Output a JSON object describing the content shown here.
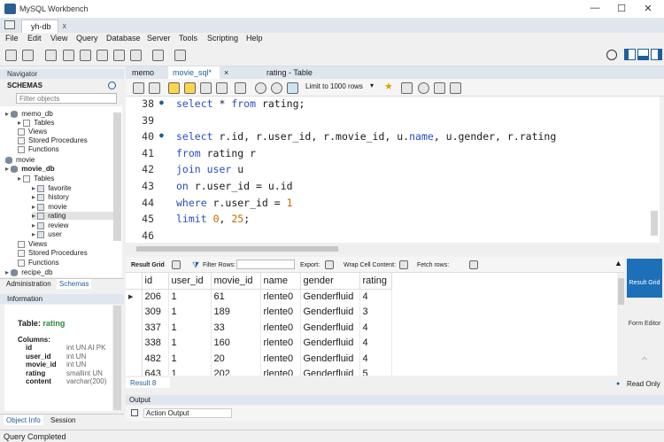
{
  "window": {
    "title": "MySQL Workbench",
    "controls": [
      "—",
      "☐",
      "✕"
    ]
  },
  "connection_tab": {
    "label": "yh-db",
    "close": "x"
  },
  "menu": [
    "File",
    "Edit",
    "View",
    "Query",
    "Database",
    "Server",
    "Tools",
    "Scripting",
    "Help"
  ],
  "navigator": {
    "header": "Navigator",
    "schemas_label": "SCHEMAS",
    "filter_placeholder": "Filter objects",
    "tree": [
      {
        "label": "memo_db",
        "level": 0,
        "kind": "db"
      },
      {
        "label": "Tables",
        "level": 1,
        "kind": "folder"
      },
      {
        "label": "Views",
        "level": 1,
        "kind": "folder"
      },
      {
        "label": "Stored Procedures",
        "level": 1,
        "kind": "folder"
      },
      {
        "label": "Functions",
        "level": 1,
        "kind": "folder"
      },
      {
        "label": "movie",
        "level": 0,
        "kind": "db"
      },
      {
        "label": "movie_db",
        "level": 0,
        "kind": "db",
        "bold": true
      },
      {
        "label": "Tables",
        "level": 1,
        "kind": "folder"
      },
      {
        "label": "favorite",
        "level": 2,
        "kind": "table"
      },
      {
        "label": "history",
        "level": 2,
        "kind": "table"
      },
      {
        "label": "movie",
        "level": 2,
        "kind": "table"
      },
      {
        "label": "rating",
        "level": 2,
        "kind": "table",
        "selected": true
      },
      {
        "label": "review",
        "level": 2,
        "kind": "table"
      },
      {
        "label": "user",
        "level": 2,
        "kind": "table"
      },
      {
        "label": "Views",
        "level": 1,
        "kind": "folder"
      },
      {
        "label": "Stored Procedures",
        "level": 1,
        "kind": "folder"
      },
      {
        "label": "Functions",
        "level": 1,
        "kind": "folder"
      },
      {
        "label": "recipe_db",
        "level": 0,
        "kind": "db"
      }
    ],
    "bottom_tabs": [
      "Administration",
      "Schemas"
    ]
  },
  "information": {
    "header": "Information",
    "table_label": "Table:",
    "table_name": "rating",
    "columns_label": "Columns:",
    "columns": [
      {
        "name": "id",
        "type": "int UN AI PK"
      },
      {
        "name": "user_id",
        "type": "int UN"
      },
      {
        "name": "movie_id",
        "type": "int UN"
      },
      {
        "name": "rating",
        "type": "smallint UN"
      },
      {
        "name": "content",
        "type": "varchar(200)"
      }
    ],
    "tabs": [
      "Object Info",
      "Session"
    ]
  },
  "editor_tabs": [
    {
      "label": "memo"
    },
    {
      "label": "movie_sql*",
      "active": true
    },
    {
      "label": "×"
    },
    {
      "label": "rating - Table"
    }
  ],
  "editor_toolbar": {
    "limit": "Limit to 1000 rows"
  },
  "code_lines": [
    {
      "n": "38",
      "dot": true,
      "tokens": [
        [
          "kw",
          "select"
        ],
        [
          "t",
          " * "
        ],
        [
          "kw",
          "from"
        ],
        [
          "t",
          " rating;"
        ]
      ]
    },
    {
      "n": "39",
      "dot": false,
      "tokens": []
    },
    {
      "n": "40",
      "dot": true,
      "tokens": [
        [
          "kw",
          "select"
        ],
        [
          "t",
          " r.id, r.user_id, r.movie_id, u."
        ],
        [
          "kw",
          "name"
        ],
        [
          "t",
          ", u.gender, r.rating"
        ]
      ]
    },
    {
      "n": "41",
      "dot": false,
      "tokens": [
        [
          "kw",
          "from"
        ],
        [
          "t",
          " rating r"
        ]
      ]
    },
    {
      "n": "42",
      "dot": false,
      "tokens": [
        [
          "kw",
          "join"
        ],
        [
          "t",
          " "
        ],
        [
          "kw",
          "user"
        ],
        [
          "t",
          " u"
        ]
      ]
    },
    {
      "n": "43",
      "dot": false,
      "tokens": [
        [
          "kw",
          "on"
        ],
        [
          "t",
          " r.user_id = u.id"
        ]
      ]
    },
    {
      "n": "44",
      "dot": false,
      "tokens": [
        [
          "kw",
          "where"
        ],
        [
          "t",
          " r.user_id = "
        ],
        [
          "num",
          "1"
        ]
      ]
    },
    {
      "n": "45",
      "dot": false,
      "tokens": [
        [
          "kw",
          "limit"
        ],
        [
          "t",
          " "
        ],
        [
          "num",
          "0"
        ],
        [
          "t",
          ", "
        ],
        [
          "num",
          "25"
        ],
        [
          "t",
          ";"
        ]
      ]
    },
    {
      "n": "46",
      "dot": false,
      "tokens": []
    }
  ],
  "result_toolbar": {
    "result_grid": "Result Grid",
    "filter_rows": "Filter Rows:",
    "export": "Export:",
    "wrap": "Wrap Cell Content:",
    "fetch": "Fetch rows:"
  },
  "grid": {
    "columns": [
      "id",
      "user_id",
      "movie_id",
      "name",
      "gender",
      "rating"
    ],
    "rows": [
      [
        "206",
        "1",
        "61",
        "rlente0",
        "Genderfluid",
        "4"
      ],
      [
        "309",
        "1",
        "189",
        "rlente0",
        "Genderfluid",
        "3"
      ],
      [
        "337",
        "1",
        "33",
        "rlente0",
        "Genderfluid",
        "4"
      ],
      [
        "338",
        "1",
        "160",
        "rlente0",
        "Genderfluid",
        "4"
      ],
      [
        "482",
        "1",
        "20",
        "rlente0",
        "Genderfluid",
        "4"
      ],
      [
        "643",
        "1",
        "202",
        "rlente0",
        "Genderfluid",
        "5"
      ]
    ]
  },
  "side_panel": {
    "result_grid": "Result Grid",
    "form_editor": "Form Editor"
  },
  "result_tab": "Result 8",
  "read_only": "Read Only",
  "output": {
    "header": "Output",
    "mode": "Action Output"
  },
  "status": "Query Completed"
}
